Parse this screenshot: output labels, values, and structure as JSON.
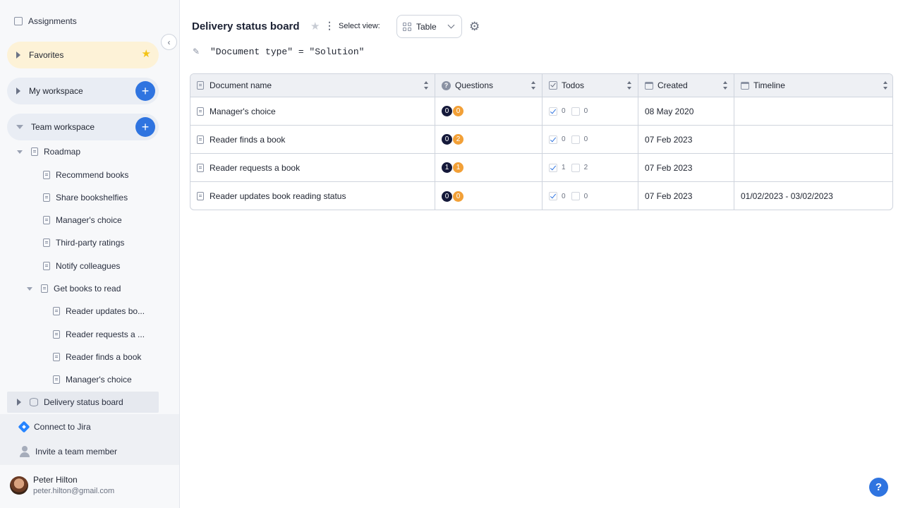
{
  "sidebar": {
    "assignments_label": "Assignments",
    "favorites_label": "Favorites",
    "my_workspace_label": "My workspace",
    "team_workspace_label": "Team workspace",
    "tree": {
      "roadmap": "Roadmap",
      "recommend_books": "Recommend books",
      "share_bookshelfies": "Share bookshelfies",
      "managers_choice": "Manager's choice",
      "third_party_ratings": "Third-party ratings",
      "notify_colleagues": "Notify colleagues",
      "get_books_to_read": "Get books to read",
      "reader_updates": "Reader updates bo...",
      "reader_requests": "Reader requests a ...",
      "reader_finds": "Reader finds a book",
      "managers_choice_2": "Manager's choice",
      "delivery_status_board": "Delivery status board"
    },
    "connect_jira_label": "Connect to Jira",
    "invite_label": "Invite a team member",
    "user": {
      "name": "Peter Hilton",
      "email": "peter.hilton@gmail.com"
    }
  },
  "header": {
    "title": "Delivery status board",
    "select_view_label": "Select view:",
    "view_value": "Table"
  },
  "filter": {
    "expression": "\"Document type\" = \"Solution\""
  },
  "table": {
    "columns": {
      "name": "Document name",
      "questions": "Questions",
      "todos": "Todos",
      "created": "Created",
      "timeline": "Timeline"
    },
    "rows": [
      {
        "name": "Manager's choice",
        "q_dark": "0",
        "q_orange": "0",
        "todo_done": "0",
        "todo_open": "0",
        "created": "08 May 2020",
        "timeline": ""
      },
      {
        "name": "Reader finds a book",
        "q_dark": "0",
        "q_orange": "2",
        "todo_done": "0",
        "todo_open": "0",
        "created": "07 Feb 2023",
        "timeline": ""
      },
      {
        "name": "Reader requests a book",
        "q_dark": "1",
        "q_orange": "1",
        "todo_done": "1",
        "todo_open": "2",
        "created": "07 Feb 2023",
        "timeline": ""
      },
      {
        "name": "Reader updates book reading status",
        "q_dark": "0",
        "q_orange": "0",
        "todo_done": "0",
        "todo_open": "0",
        "created": "07 Feb 2023",
        "timeline": "01/02/2023 - 03/02/2023"
      }
    ]
  },
  "help_label": "?",
  "colors": {
    "accent": "#2f74e0",
    "favorites_bg": "#fdf2d7",
    "badge_dark": "#15193a",
    "badge_orange": "#f2a037"
  }
}
